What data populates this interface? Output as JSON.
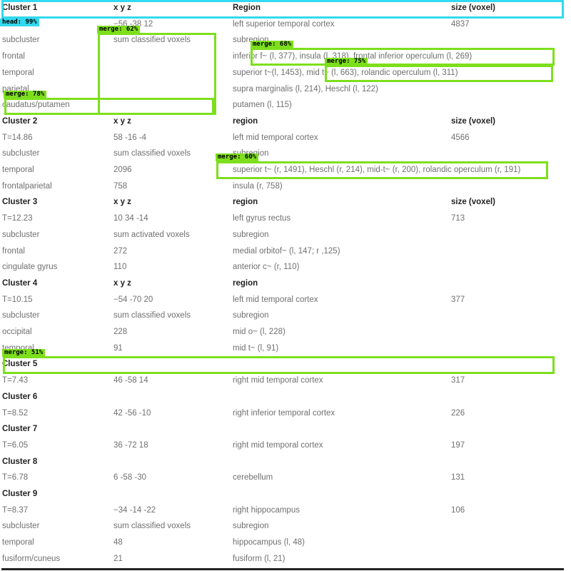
{
  "table": {
    "rows": [
      {
        "kind": "header",
        "term": "Cluster 1",
        "xyz": "x y z",
        "region": "Region",
        "size": "size (voxel)"
      },
      {
        "kind": "data",
        "term": "T=...",
        "xyz": "−56 -38 12",
        "region": "left superior temporal cortex",
        "size": "4837"
      },
      {
        "kind": "data",
        "term": "subcluster",
        "xyz": "sum classified voxels",
        "region": "subregion",
        "size": ""
      },
      {
        "kind": "data",
        "term": "frontal",
        "xyz": "",
        "region": "inferior f~ (l, 377), insula (l, 318), frontal inferior operculum (l, 269)",
        "size": ""
      },
      {
        "kind": "data",
        "term": "temporal",
        "xyz": "",
        "region": "superior t~(l, 1453), mid t~ (l, 663), rolandic operculum (l, 311)",
        "size": ""
      },
      {
        "kind": "data",
        "term": "parietal",
        "xyz": "",
        "region": "supra marginalis (l, 214), Heschl (l, 122)",
        "size": ""
      },
      {
        "kind": "data",
        "term": "caudatus/putamen",
        "xyz": "",
        "region": "putamen (l, 115)",
        "size": ""
      },
      {
        "kind": "header",
        "term": "Cluster 2",
        "xyz": "x y z",
        "region": "region",
        "size": "size (voxel)"
      },
      {
        "kind": "data",
        "term": "T=14.86",
        "xyz": "58 -16 -4",
        "region": "left mid temporal cortex",
        "size": "4566"
      },
      {
        "kind": "data",
        "term": "subcluster",
        "xyz": "sum classified voxels",
        "region": "subregion",
        "size": ""
      },
      {
        "kind": "data",
        "term": "temporal",
        "xyz": "2096",
        "region": "superior t~ (r, 1491), Heschl (r, 214), mid-t~ (r, 200), rolandic operculum (r, 191)",
        "size": ""
      },
      {
        "kind": "data",
        "term": "frontalparietal",
        "xyz": "758",
        "region": "insula (r, 758)",
        "size": ""
      },
      {
        "kind": "header",
        "term": "Cluster 3",
        "xyz": "x y z",
        "region": "region",
        "size": "size (voxel)"
      },
      {
        "kind": "data",
        "term": "T=12.23",
        "xyz": "10 34 -14",
        "region": "left gyrus rectus",
        "size": "713"
      },
      {
        "kind": "data",
        "term": "subcluster",
        "xyz": "sum activated voxels",
        "region": "subregion",
        "size": ""
      },
      {
        "kind": "data",
        "term": "frontal",
        "xyz": "272",
        "region": "medial orbitof~ (l, 147; r ,125)",
        "size": ""
      },
      {
        "kind": "data",
        "term": "cingulate gyrus",
        "xyz": "110",
        "region": "anterior c~ (r, 110)",
        "size": ""
      },
      {
        "kind": "header",
        "term": "Cluster 4",
        "xyz": "x y z",
        "region": "region",
        "size": ""
      },
      {
        "kind": "data",
        "term": "T=10.15",
        "xyz": "−54 -70 20",
        "region": "left mid temporal cortex",
        "size": "377"
      },
      {
        "kind": "data",
        "term": "subcluster",
        "xyz": "sum classified voxels",
        "region": "subregion",
        "size": ""
      },
      {
        "kind": "data",
        "term": "occipital",
        "xyz": "228",
        "region": "mid o~ (l, 228)",
        "size": ""
      },
      {
        "kind": "data",
        "term": "temporal",
        "xyz": "91",
        "region": "mid t~ (l, 91)",
        "size": ""
      },
      {
        "kind": "header",
        "term": "Cluster 5",
        "xyz": "",
        "region": "",
        "size": ""
      },
      {
        "kind": "data",
        "term": "T=7.43",
        "xyz": "46 -58 14",
        "region": "right mid temporal cortex",
        "size": "317"
      },
      {
        "kind": "header",
        "term": "Cluster 6",
        "xyz": "",
        "region": "",
        "size": ""
      },
      {
        "kind": "data",
        "term": "T=8.52",
        "xyz": "42 -56 -10",
        "region": "right inferior temporal cortex",
        "size": "226"
      },
      {
        "kind": "header",
        "term": "Cluster 7",
        "xyz": "",
        "region": "",
        "size": ""
      },
      {
        "kind": "data",
        "term": "T=6.05",
        "xyz": "36 -72 18",
        "region": "right mid temporal cortex",
        "size": "197"
      },
      {
        "kind": "header",
        "term": "Cluster 8",
        "xyz": "",
        "region": "",
        "size": ""
      },
      {
        "kind": "data",
        "term": "T=6.78",
        "xyz": "6 -58 -30",
        "region": "cerebellum",
        "size": "131"
      },
      {
        "kind": "header",
        "term": "Cluster 9",
        "xyz": "",
        "region": "",
        "size": ""
      },
      {
        "kind": "data",
        "term": "T=8.37",
        "xyz": "−34 -14 -22",
        "region": "right hippocampus",
        "size": "106"
      },
      {
        "kind": "data",
        "term": "subcluster",
        "xyz": "sum classified voxels",
        "region": "subregion",
        "size": ""
      },
      {
        "kind": "data",
        "term": "temporal",
        "xyz": "48",
        "region": "hippocampus (l, 48)",
        "size": ""
      },
      {
        "kind": "data",
        "term": "fusiform/cuneus",
        "xyz": "21",
        "region": "fusiform (l, 21)",
        "size": ""
      }
    ]
  },
  "detections": [
    {
      "label": "head: 99%",
      "color": "#33d9ee"
    },
    {
      "label": "merge: 62%",
      "color": "#7ddf1c"
    },
    {
      "label": "merge: 68%",
      "color": "#7ddf1c"
    },
    {
      "label": "merge: 75%",
      "color": "#7ddf1c"
    },
    {
      "label": "merge: 78%",
      "color": "#7ddf1c"
    },
    {
      "label": "merge: 60%",
      "color": "#7ddf1c"
    },
    {
      "label": "merge: 51%",
      "color": "#7ddf1c"
    }
  ]
}
